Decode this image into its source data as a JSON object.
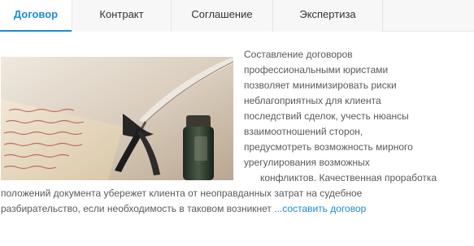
{
  "tabs": [
    {
      "label": "Договор"
    },
    {
      "label": "Контракт"
    },
    {
      "label": "Соглашение"
    },
    {
      "label": "Экспертиза"
    }
  ],
  "article": {
    "lines": [
      "Составление договоров",
      "профессиональными юристами",
      "позволяет минимизировать риски",
      "неблагоприятных для клиента",
      "последствий сделок, учесть нюансы",
      "взаимоотношений сторон,",
      "предусмотреть возможность мирного",
      "урегулирования возможных",
      "конфликтов. Качественная проработка",
      "положений документа убережет клиента от неоправданных затрат на судебное",
      "разбирательство, если необходимость в таковом возникнет "
    ],
    "more_link": "...составить договор"
  },
  "image": {
    "subject": "feather-quill-ink-bottle-document-photo"
  },
  "colors": {
    "accent": "#1f8ad2",
    "text": "#5a5a5a",
    "tab_bg": "#f7f7f7"
  }
}
